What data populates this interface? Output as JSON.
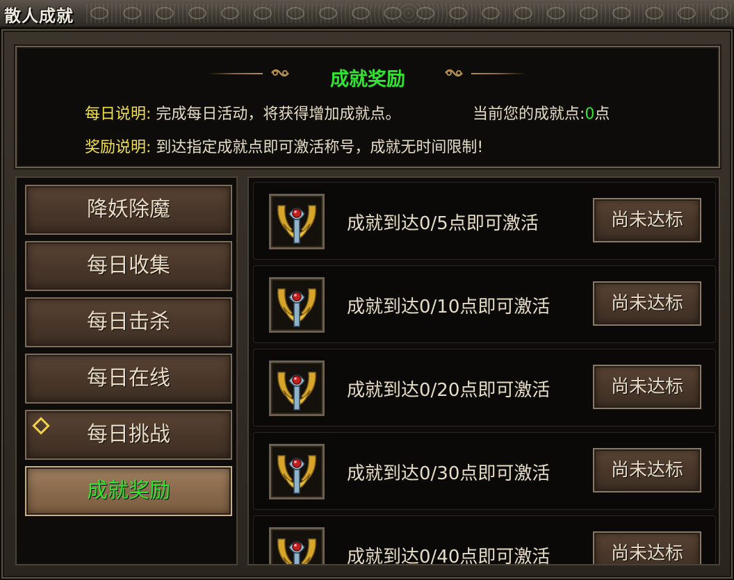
{
  "window": {
    "title": "散人成就"
  },
  "info": {
    "title": "成就奖励",
    "daily_label": "每日说明:",
    "daily_text": "完成每日活动，将获得增加成就点。",
    "points_label": "当前您的成就点:",
    "points_value": "0",
    "points_unit": "点",
    "reward_label": "奖励说明:",
    "reward_text": "到达指定成就点即可激活称号，成就无时间限制!"
  },
  "nav": {
    "items": [
      {
        "label": "降妖除魔"
      },
      {
        "label": "每日收集"
      },
      {
        "label": "每日击杀"
      },
      {
        "label": "每日在线"
      },
      {
        "label": "每日挑战"
      },
      {
        "label": "成就奖励"
      }
    ],
    "active_index": 5
  },
  "rewards": [
    {
      "text": "成就到达0/5点即可激活",
      "button": "尚未达标"
    },
    {
      "text": "成就到达0/10点即可激活",
      "button": "尚未达标"
    },
    {
      "text": "成就到达0/20点即可激活",
      "button": "尚未达标"
    },
    {
      "text": "成就到达0/30点即可激活",
      "button": "尚未达标"
    },
    {
      "text": "成就到达0/40点即可激活",
      "button": "尚未达标"
    }
  ],
  "colors": {
    "accent_green": "#2fe52f",
    "label_yellow": "#f2e24a",
    "text": "#e6dcc6"
  },
  "icons": {
    "reward_icon": "winged-title-emblem-icon",
    "nav_marker": "diamond-icon"
  }
}
